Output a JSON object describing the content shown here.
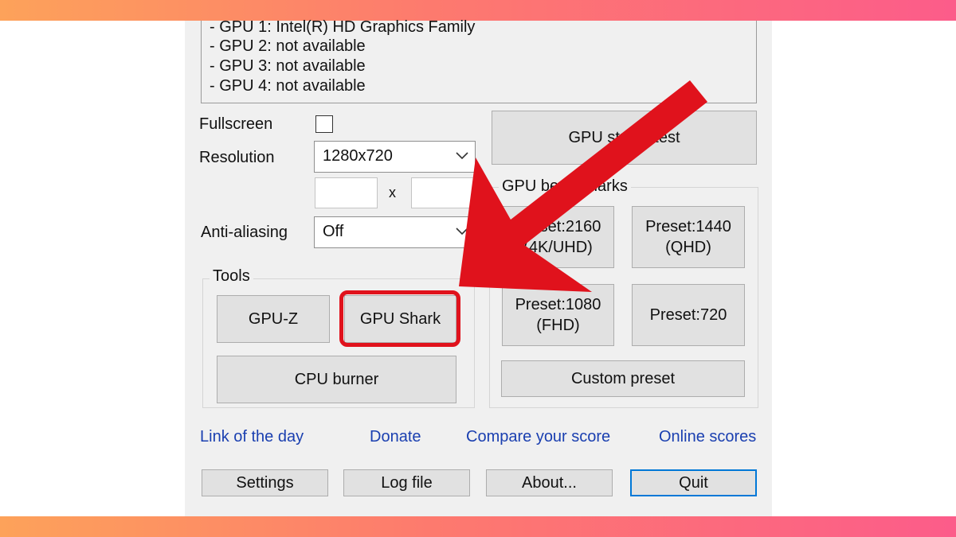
{
  "gpu_list": [
    "- GPU 1: Intel(R) HD Graphics Family",
    "- GPU 2: not available",
    "- GPU 3: not available",
    "- GPU 4: not available"
  ],
  "settings": {
    "fullscreen_label": "Fullscreen",
    "fullscreen_checked": false,
    "resolution_label": "Resolution",
    "resolution_value": "1280x720",
    "custom_x_separator": "x",
    "antialiasing_label": "Anti-aliasing",
    "antialiasing_value": "Off"
  },
  "tools": {
    "group_title": "Tools",
    "gpuz": "GPU-Z",
    "gpu_shark": "GPU Shark",
    "cpu_burner": "CPU burner"
  },
  "stress_test": {
    "label": "GPU stress test"
  },
  "benchmarks": {
    "group_title": "GPU benchmarks",
    "preset_2160": "Preset:2160\n(4K/UHD)",
    "preset_1440": "Preset:1440\n(QHD)",
    "preset_1080": "Preset:1080\n(FHD)",
    "preset_720": "Preset:720",
    "custom": "Custom preset"
  },
  "links": {
    "link_of_day": "Link of the day",
    "donate": "Donate",
    "compare": "Compare your score",
    "online": "Online scores"
  },
  "footer": {
    "settings": "Settings",
    "log_file": "Log file",
    "about": "About...",
    "quit": "Quit"
  },
  "annotation": {
    "color": "#e0121c",
    "target": "GPU Shark"
  },
  "colors": {
    "link": "#1a3fb0",
    "focus_border": "#0078d7",
    "button_face": "#e1e1e1"
  }
}
